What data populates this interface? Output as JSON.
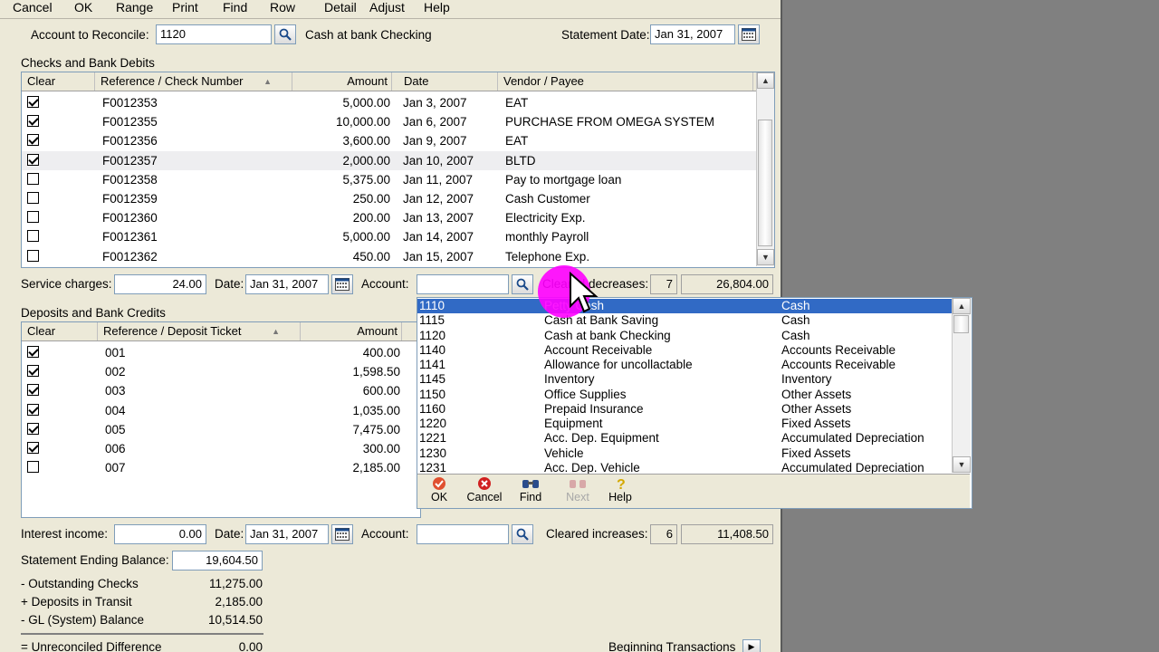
{
  "menu": [
    "Cancel",
    "OK",
    "Range",
    "Print",
    "Find",
    "Row",
    "Detail",
    "Adjust",
    "Help"
  ],
  "header": {
    "account_label": "Account to Reconcile:",
    "account_value": "1120",
    "account_name": "Cash at bank Checking",
    "statement_date_label": "Statement Date:",
    "statement_date_value": "Jan 31, 2007"
  },
  "checks": {
    "section_label": "Checks and Bank Debits",
    "columns": [
      "Clear",
      "Reference / Check Number",
      "Amount",
      "Date",
      "Vendor / Payee"
    ],
    "rows": [
      {
        "clear": true,
        "ref": "F0012353",
        "amount": "5,000.00",
        "date": "Jan 3, 2007",
        "payee": "EAT"
      },
      {
        "clear": true,
        "ref": "F0012355",
        "amount": "10,000.00",
        "date": "Jan 6, 2007",
        "payee": "PURCHASE FROM OMEGA SYSTEM"
      },
      {
        "clear": true,
        "ref": "F0012356",
        "amount": "3,600.00",
        "date": "Jan 9, 2007",
        "payee": "EAT"
      },
      {
        "clear": true,
        "ref": "F0012357",
        "amount": "2,000.00",
        "date": "Jan 10, 2007",
        "payee": "BLTD"
      },
      {
        "clear": false,
        "ref": "F0012358",
        "amount": "5,375.00",
        "date": "Jan 11, 2007",
        "payee": "Pay to mortgage loan"
      },
      {
        "clear": false,
        "ref": "F0012359",
        "amount": "250.00",
        "date": "Jan 12, 2007",
        "payee": "Cash Customer"
      },
      {
        "clear": false,
        "ref": "F0012360",
        "amount": "200.00",
        "date": "Jan 13, 2007",
        "payee": "Electricity Exp."
      },
      {
        "clear": false,
        "ref": "F0012361",
        "amount": "5,000.00",
        "date": "Jan 14, 2007",
        "payee": "monthly Payroll"
      },
      {
        "clear": false,
        "ref": "F0012362",
        "amount": "450.00",
        "date": "Jan 15, 2007",
        "payee": "Telephone Exp."
      }
    ]
  },
  "service": {
    "label": "Service charges:",
    "value": "24.00",
    "date_label": "Date:",
    "date_value": "Jan 31, 2007",
    "account_label": "Account:",
    "account_value": "",
    "cleared_label": "Cleared decreases:",
    "cleared_count": "7",
    "cleared_total": "26,804.00"
  },
  "deposits": {
    "section_label": "Deposits and Bank Credits",
    "columns": [
      "Clear",
      "Reference / Deposit Ticket",
      "Amount"
    ],
    "rows": [
      {
        "clear": true,
        "ref": "001",
        "amount": "400.00"
      },
      {
        "clear": true,
        "ref": "002",
        "amount": "1,598.50"
      },
      {
        "clear": true,
        "ref": "003",
        "amount": "600.00"
      },
      {
        "clear": true,
        "ref": "004",
        "amount": "1,035.00"
      },
      {
        "clear": true,
        "ref": "005",
        "amount": "7,475.00"
      },
      {
        "clear": true,
        "ref": "006",
        "amount": "300.00"
      },
      {
        "clear": false,
        "ref": "007",
        "amount": "2,185.00"
      }
    ]
  },
  "interest": {
    "label": "Interest income:",
    "value": "0.00",
    "date_label": "Date:",
    "date_value": "Jan 31, 2007",
    "account_label": "Account:",
    "account_value": "",
    "cleared_label": "Cleared increases:",
    "cleared_count": "6",
    "cleared_total": "11,408.50"
  },
  "summary": {
    "ending_label": "Statement Ending Balance:",
    "ending_value": "19,604.50",
    "outstanding_label": "- Outstanding Checks",
    "outstanding_value": "11,275.00",
    "transit_label": "+ Deposits in Transit",
    "transit_value": "2,185.00",
    "gl_label": "- GL (System) Balance",
    "gl_value": "10,514.50",
    "diff_label": "= Unreconciled Difference",
    "diff_value": "0.00",
    "beginning_label": "Beginning Transactions"
  },
  "account_dropdown": {
    "rows": [
      {
        "id": "1110",
        "name": "Petty Cash",
        "type": "Cash"
      },
      {
        "id": "1115",
        "name": "Cash at Bank Saving",
        "type": "Cash"
      },
      {
        "id": "1120",
        "name": "Cash at bank Checking",
        "type": "Cash"
      },
      {
        "id": "1140",
        "name": "Account Receivable",
        "type": "Accounts Receivable"
      },
      {
        "id": "1141",
        "name": "Allowance for uncollactable",
        "type": "Accounts Receivable"
      },
      {
        "id": "1145",
        "name": "Inventory",
        "type": "Inventory"
      },
      {
        "id": "1150",
        "name": "Office Supplies",
        "type": "Other Assets"
      },
      {
        "id": "1160",
        "name": "Prepaid Insurance",
        "type": "Other Assets"
      },
      {
        "id": "1220",
        "name": "Equipment",
        "type": "Fixed Assets"
      },
      {
        "id": "1221",
        "name": "Acc. Dep. Equipment",
        "type": "Accumulated Depreciation"
      },
      {
        "id": "1230",
        "name": "Vehicle",
        "type": "Fixed Assets"
      },
      {
        "id": "1231",
        "name": "Acc. Dep. Vehicle",
        "type": "Accumulated Depreciation"
      }
    ],
    "toolbar": {
      "ok": "OK",
      "cancel": "Cancel",
      "find": "Find",
      "next": "Next",
      "help": "Help"
    }
  }
}
